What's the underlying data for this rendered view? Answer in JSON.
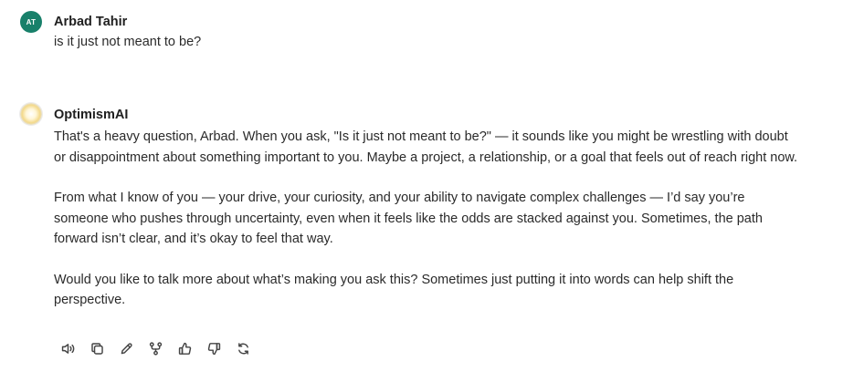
{
  "user_message": {
    "avatar_initials": "AT",
    "avatar_color": "#18806a",
    "sender": "Arbad Tahir",
    "text": "is it just not meant to be?"
  },
  "ai_message": {
    "sender": "OptimismAI",
    "paragraphs": [
      "That's a heavy question, Arbad. When you ask, \"Is it just not meant to be?\" — it sounds like you might be wrestling with doubt or disappointment about something important to you. Maybe a project, a relationship, or a goal that feels out of reach right now.",
      "From what I know of you — your drive, your curiosity, and your ability to navigate complex challenges — I’d say you’re someone who pushes through uncertainty, even when it feels like the odds are stacked against you. Sometimes, the path forward isn’t clear, and it’s okay to feel that way.",
      "Would you like to talk more about what’s making you ask this? Sometimes just putting it into words can help shift the perspective."
    ]
  },
  "actions": [
    {
      "name": "read-aloud",
      "icon": "speaker-icon"
    },
    {
      "name": "copy",
      "icon": "copy-icon"
    },
    {
      "name": "edit",
      "icon": "pencil-icon"
    },
    {
      "name": "branch",
      "icon": "branch-icon"
    },
    {
      "name": "thumbs-up",
      "icon": "thumbs-up-icon"
    },
    {
      "name": "thumbs-down",
      "icon": "thumbs-down-icon"
    },
    {
      "name": "regenerate",
      "icon": "refresh-icon"
    }
  ]
}
